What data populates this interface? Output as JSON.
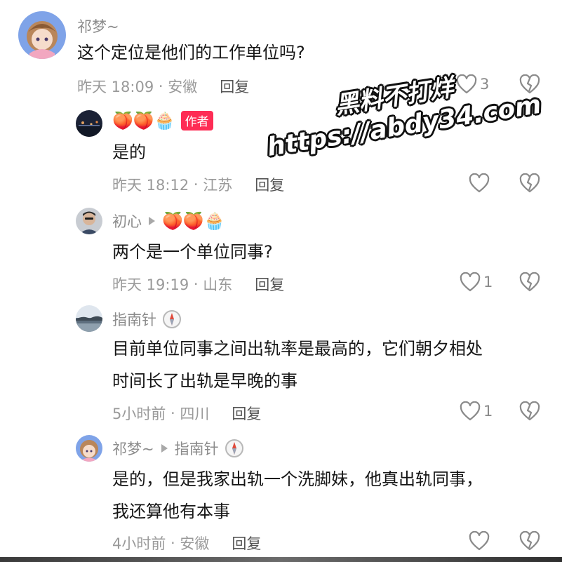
{
  "comments": [
    {
      "author": "祁梦~",
      "text_lines": [
        "这个定位是他们的工作单位吗?"
      ],
      "time": "昨天 18:09",
      "location": "安徽",
      "reply_label": "回复",
      "like_count": "3"
    },
    {
      "author_emojis": "🍑🍑🧁",
      "badge": "作者",
      "text_lines": [
        "是的"
      ],
      "time": "昨天 18:12",
      "location": "江苏",
      "reply_label": "回复",
      "like_count": ""
    },
    {
      "author": "初心",
      "author_emojis": "🍑🍑🧁",
      "text_lines": [
        "两个是一个单位同事?"
      ],
      "time": "昨天 19:19",
      "location": "山东",
      "reply_label": "回复",
      "like_count": "1"
    },
    {
      "author": "指南针",
      "text_lines": [
        "目前单位同事之间出轨率是最高的，它们朝夕相处",
        "时间长了出轨是早晚的事"
      ],
      "time": "5小时前",
      "location": "四川",
      "reply_label": "回复",
      "like_count": "1"
    },
    {
      "author": "祁梦~",
      "reply_to": "指南针",
      "text_lines": [
        "是的，但是我家出轨一个洗脚妹，他真出轨同事，",
        "我还算他有本事"
      ],
      "time": "4小时前",
      "location": "安徽",
      "reply_label": "回复",
      "like_count": ""
    }
  ],
  "watermark": {
    "line1": "黑料不打烊",
    "line2": "https://abdy34.com"
  },
  "colors": {
    "author_badge": "#fe2c55",
    "meta_text": "#9a9a9a",
    "body_text": "#161616"
  }
}
